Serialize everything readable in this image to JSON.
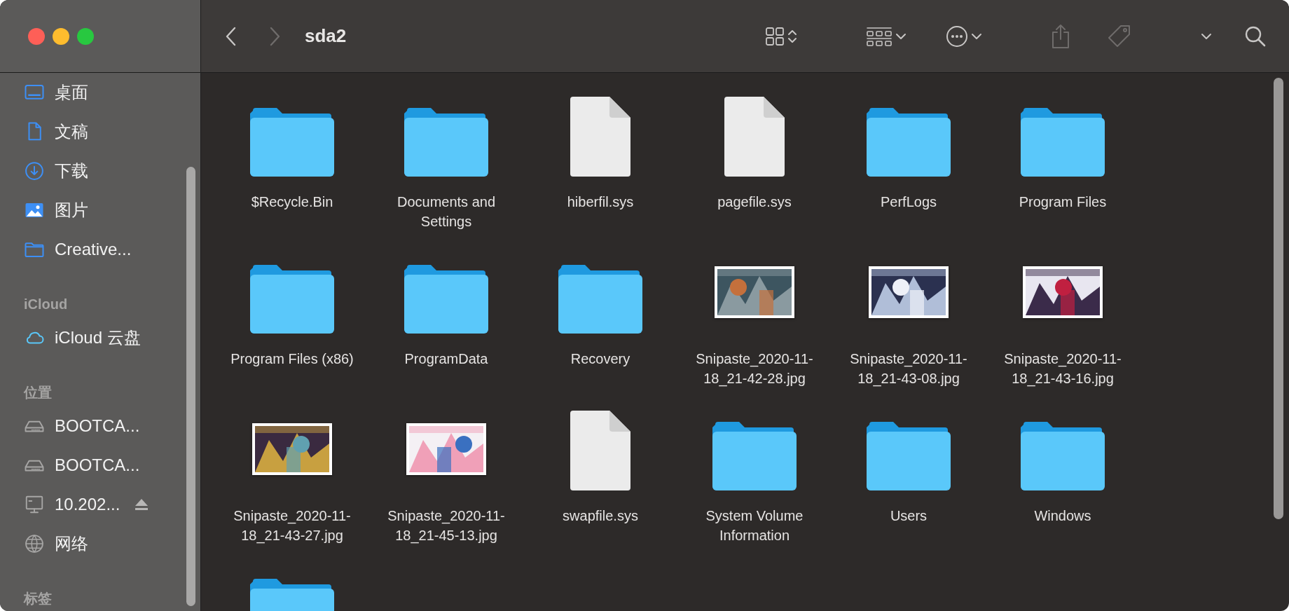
{
  "window": {
    "title": "sda2"
  },
  "toolbar": {
    "back": {
      "disabled": false
    },
    "forward": {
      "disabled": true
    },
    "share": {
      "disabled": true
    },
    "tag": {
      "disabled": true
    }
  },
  "sidebar": {
    "sections": [
      {
        "items": [
          {
            "label": "桌面",
            "kind": "desktop"
          },
          {
            "label": "文稿",
            "kind": "document"
          },
          {
            "label": "下载",
            "kind": "download"
          },
          {
            "label": "图片",
            "kind": "pictures"
          },
          {
            "label": "Creative...",
            "kind": "folder"
          }
        ]
      },
      {
        "title": "iCloud",
        "items": [
          {
            "label": "iCloud 云盘",
            "kind": "cloud"
          }
        ]
      },
      {
        "title": "位置",
        "items": [
          {
            "label": "BOOTCA...",
            "kind": "disk"
          },
          {
            "label": "BOOTCA...",
            "kind": "disk"
          },
          {
            "label": "10.202...",
            "kind": "computer",
            "eject": true
          },
          {
            "label": "网络",
            "kind": "network"
          }
        ]
      },
      {
        "title": "标签"
      }
    ]
  },
  "files": [
    {
      "name": "$Recycle.Bin",
      "kind": "folder"
    },
    {
      "name": "Documents and Settings",
      "kind": "folder"
    },
    {
      "name": "hiberfil.sys",
      "kind": "file"
    },
    {
      "name": "pagefile.sys",
      "kind": "file"
    },
    {
      "name": "PerfLogs",
      "kind": "folder"
    },
    {
      "name": "Program Files",
      "kind": "folder"
    },
    {
      "name": "Program Files (x86)",
      "kind": "folder"
    },
    {
      "name": "ProgramData",
      "kind": "folder"
    },
    {
      "name": "Recovery",
      "kind": "folder"
    },
    {
      "name": "Snipaste_2020-11-18_21-42-28.jpg"
    },
    {
      "name": "Snipaste_2020-11-18_21-43-08.jpg"
    },
    {
      "name": "Snipaste_2020-11-18_21-43-16.jpg"
    },
    {
      "name": "Snipaste_2020-11-18_21-43-27.jpg"
    },
    {
      "name": "Snipaste_2020-11-18_21-45-13.jpg"
    },
    {
      "name": "swapfile.sys",
      "kind": "file"
    },
    {
      "name": "System Volume Information",
      "kind": "folder"
    },
    {
      "name": "Users",
      "kind": "folder"
    },
    {
      "name": "Windows",
      "kind": "folder"
    },
    {
      "kind": "folder"
    }
  ]
}
